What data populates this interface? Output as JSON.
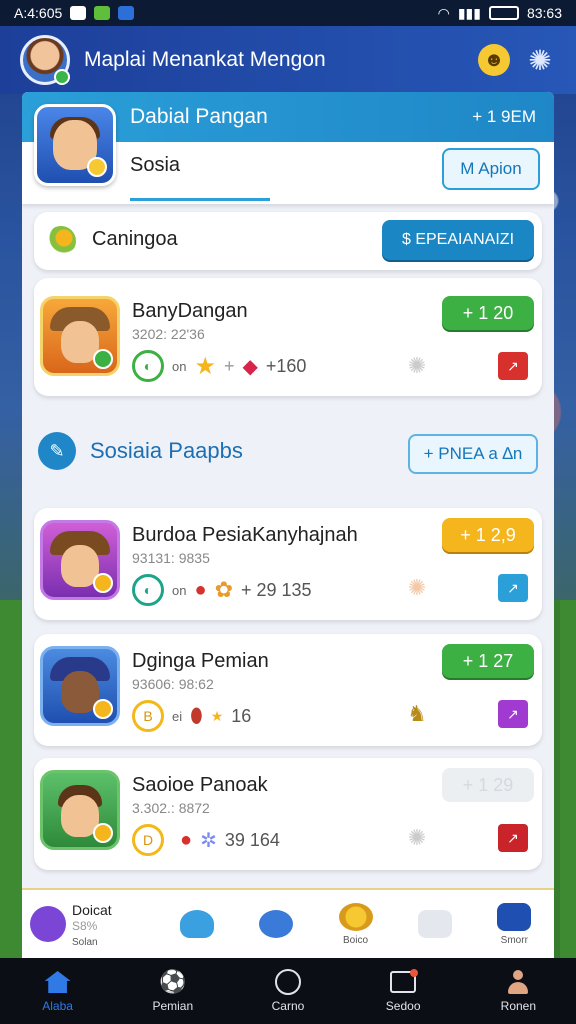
{
  "status_bar": {
    "time_left": "A:4:605",
    "time_right": "83:63"
  },
  "app_bar": {
    "title": "Maplai Menankat Mengon"
  },
  "profile_card": {
    "title": "Dabial Pangan",
    "plus_label": "+ 1 9EM",
    "subtitle": "Sosia",
    "action_label": "M Apion"
  },
  "challenge_row": {
    "title": "Caningoa",
    "button_label": "$ EPEAIANAIZI"
  },
  "first_game": {
    "title": "BanyDangan",
    "sub": "3202: 22'36",
    "pill": "+ 1 20",
    "stat_prefix": "on",
    "stat_value": "+160"
  },
  "section": {
    "title": "Sosiaia Paapbs",
    "button_label": "+ PNEA a ∆n"
  },
  "games": [
    {
      "title": "Burdoa PesiaKanyhajnah",
      "sub": "93131: 9835",
      "pill": "+ 1 2,9",
      "stat_prefix": "on",
      "stat_value": "+ 29 135"
    },
    {
      "title": "Dginga Pemian",
      "sub": "93606: 98:62",
      "pill": "+ 1 27",
      "stat_prefix": "ei",
      "stat_value": "16"
    },
    {
      "title": "Saoioe Panoak",
      "sub": "3.302.: 8872",
      "pill": "+ 1 29",
      "stat_prefix": "",
      "stat_value": "39 164"
    }
  ],
  "quick_bar": {
    "first_title": "Doicat",
    "first_sub": "S8%",
    "first_label": "Solan",
    "labels": [
      "",
      "",
      "",
      "Boico",
      "",
      "Smorr"
    ]
  },
  "nav": {
    "items": [
      {
        "label": "Alaba"
      },
      {
        "label": "Pemian"
      },
      {
        "label": "Carno"
      },
      {
        "label": "Sedoo"
      },
      {
        "label": "Ronen"
      }
    ]
  },
  "colors": {
    "accent": "#2a9fd8",
    "green": "#3cb043",
    "yellow": "#f5b51c",
    "nav_active": "#2f7ae5"
  }
}
